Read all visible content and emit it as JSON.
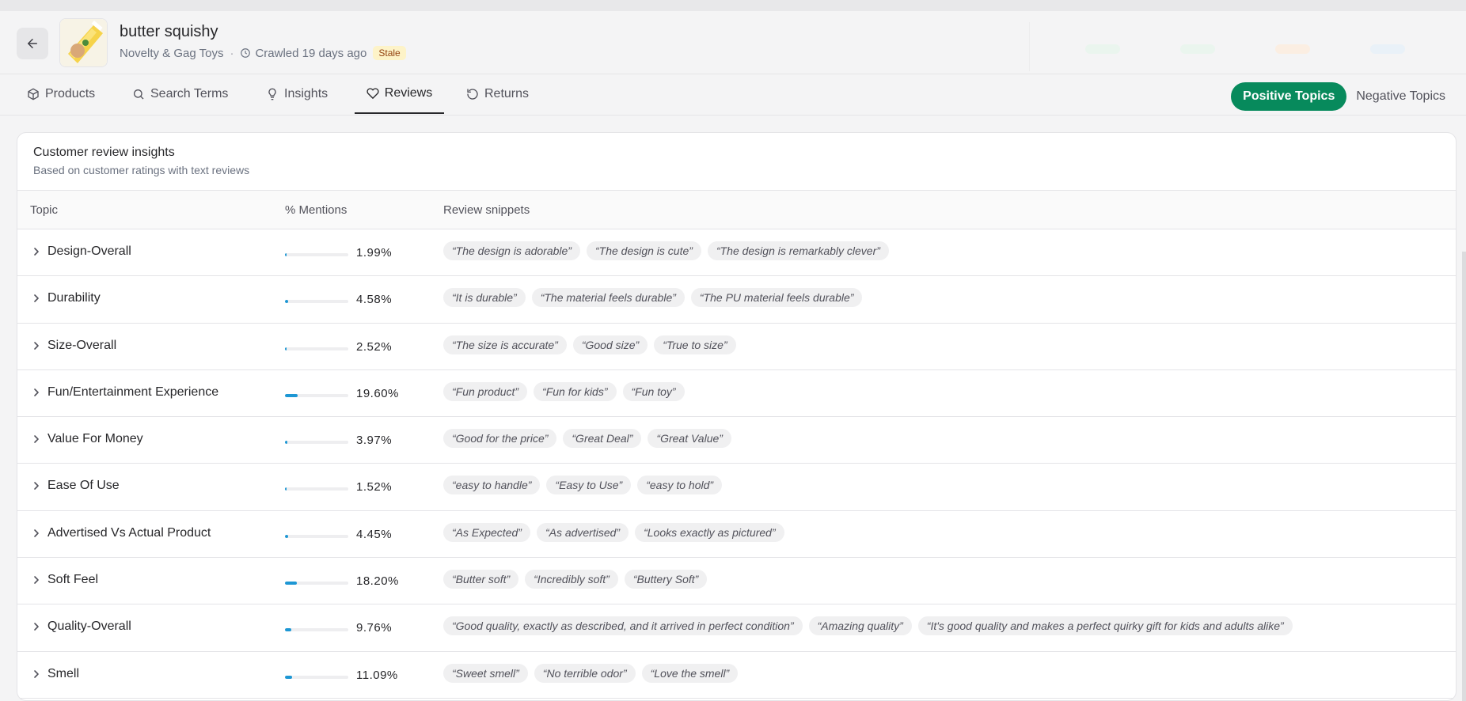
{
  "header": {
    "title": "butter squishy",
    "category": "Novelty & Gag Toys",
    "crawled": "Crawled 19 days ago",
    "badge": "Stale"
  },
  "tabs": [
    {
      "label": "Products",
      "icon": "box-icon"
    },
    {
      "label": "Search Terms",
      "icon": "search-icon"
    },
    {
      "label": "Insights",
      "icon": "lightbulb-icon"
    },
    {
      "label": "Reviews",
      "icon": "heart-icon"
    },
    {
      "label": "Returns",
      "icon": "rotate-ccw-icon"
    }
  ],
  "active_tab": "Reviews",
  "toggle": {
    "positive": "Positive Topics",
    "negative": "Negative Topics",
    "selected": "Positive Topics"
  },
  "colors": {
    "accent_green": "#078a5c",
    "bar_blue": "#1d97d4",
    "stale_bg": "#fdf3c8"
  },
  "card": {
    "title": "Customer review insights",
    "subtitle": "Based on customer ratings with text reviews"
  },
  "table": {
    "headers": {
      "topic": "Topic",
      "mentions": "% Mentions",
      "snippets": "Review snippets"
    },
    "rows": [
      {
        "topic": "Design-Overall",
        "pct": "1.99%",
        "value": 1.99,
        "snippets": [
          "“The design is adorable”",
          "“The design is cute”",
          "“The design is remarkably clever”"
        ]
      },
      {
        "topic": "Durability",
        "pct": "4.58%",
        "value": 4.58,
        "snippets": [
          "“It is durable”",
          "“The material feels durable”",
          "“The PU material feels durable”"
        ]
      },
      {
        "topic": "Size-Overall",
        "pct": "2.52%",
        "value": 2.52,
        "snippets": [
          "“The size is accurate”",
          "“Good size”",
          "“True to size”"
        ]
      },
      {
        "topic": "Fun/Entertainment Experience",
        "pct": "19.60%",
        "value": 19.6,
        "snippets": [
          "“Fun product”",
          "“Fun for kids”",
          "“Fun toy”"
        ]
      },
      {
        "topic": "Value For Money",
        "pct": "3.97%",
        "value": 3.97,
        "snippets": [
          "“Good for the price”",
          "“Great Deal”",
          "“Great Value”"
        ]
      },
      {
        "topic": "Ease Of Use",
        "pct": "1.52%",
        "value": 1.52,
        "snippets": [
          "“easy to handle”",
          "“Easy to Use”",
          "“easy to hold”"
        ]
      },
      {
        "topic": "Advertised Vs Actual Product",
        "pct": "4.45%",
        "value": 4.45,
        "snippets": [
          "“As Expected”",
          "“As advertised”",
          "“Looks exactly as pictured”"
        ]
      },
      {
        "topic": "Soft Feel",
        "pct": "18.20%",
        "value": 18.2,
        "snippets": [
          "“Butter soft”",
          "“Incredibly soft”",
          "“Buttery Soft”"
        ]
      },
      {
        "topic": "Quality-Overall",
        "pct": "9.76%",
        "value": 9.76,
        "snippets": [
          "“Good quality, exactly as described, and it arrived in perfect condition”",
          "“Amazing quality”",
          "“It's good quality and makes a perfect quirky gift for kids and adults alike”"
        ]
      },
      {
        "topic": "Smell",
        "pct": "11.09%",
        "value": 11.09,
        "snippets": [
          "“Sweet smell”",
          "“No terrible odor”",
          "“Love the smell”"
        ]
      }
    ]
  }
}
